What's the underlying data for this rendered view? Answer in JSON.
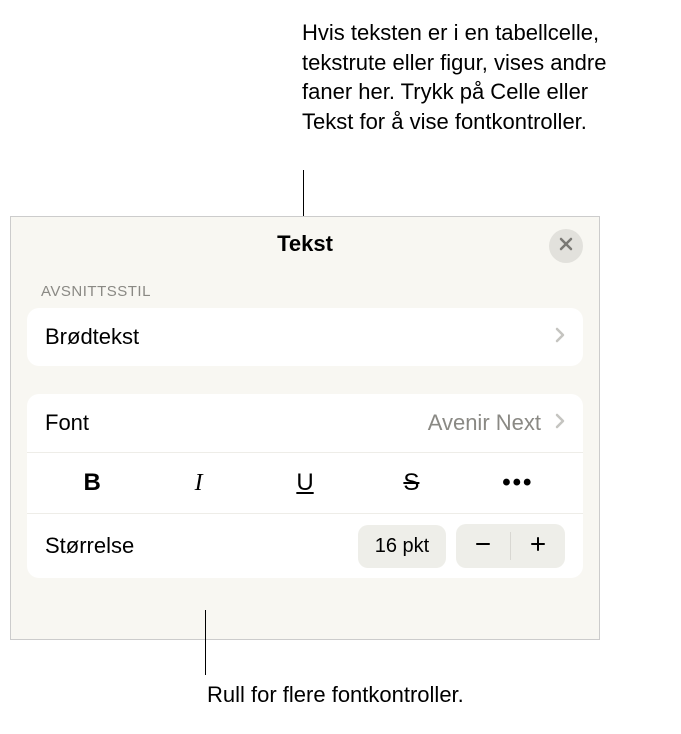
{
  "callouts": {
    "top": "Hvis teksten er i en tabellcelle, tekstrute eller figur, vises andre faner her. Trykk på Celle eller Tekst for å vise fontkontroller.",
    "bottom": "Rull for flere fontkontroller."
  },
  "panel": {
    "title": "Tekst",
    "section_paragraph_style": "AVSNITTSSTIL",
    "paragraph_style_value": "Brødtekst",
    "font_label": "Font",
    "font_value": "Avenir Next",
    "style_buttons": {
      "bold": "B",
      "italic": "I",
      "underline": "U",
      "strike": "S",
      "more": "•••"
    },
    "size_label": "Størrelse",
    "size_value": "16 pkt"
  }
}
